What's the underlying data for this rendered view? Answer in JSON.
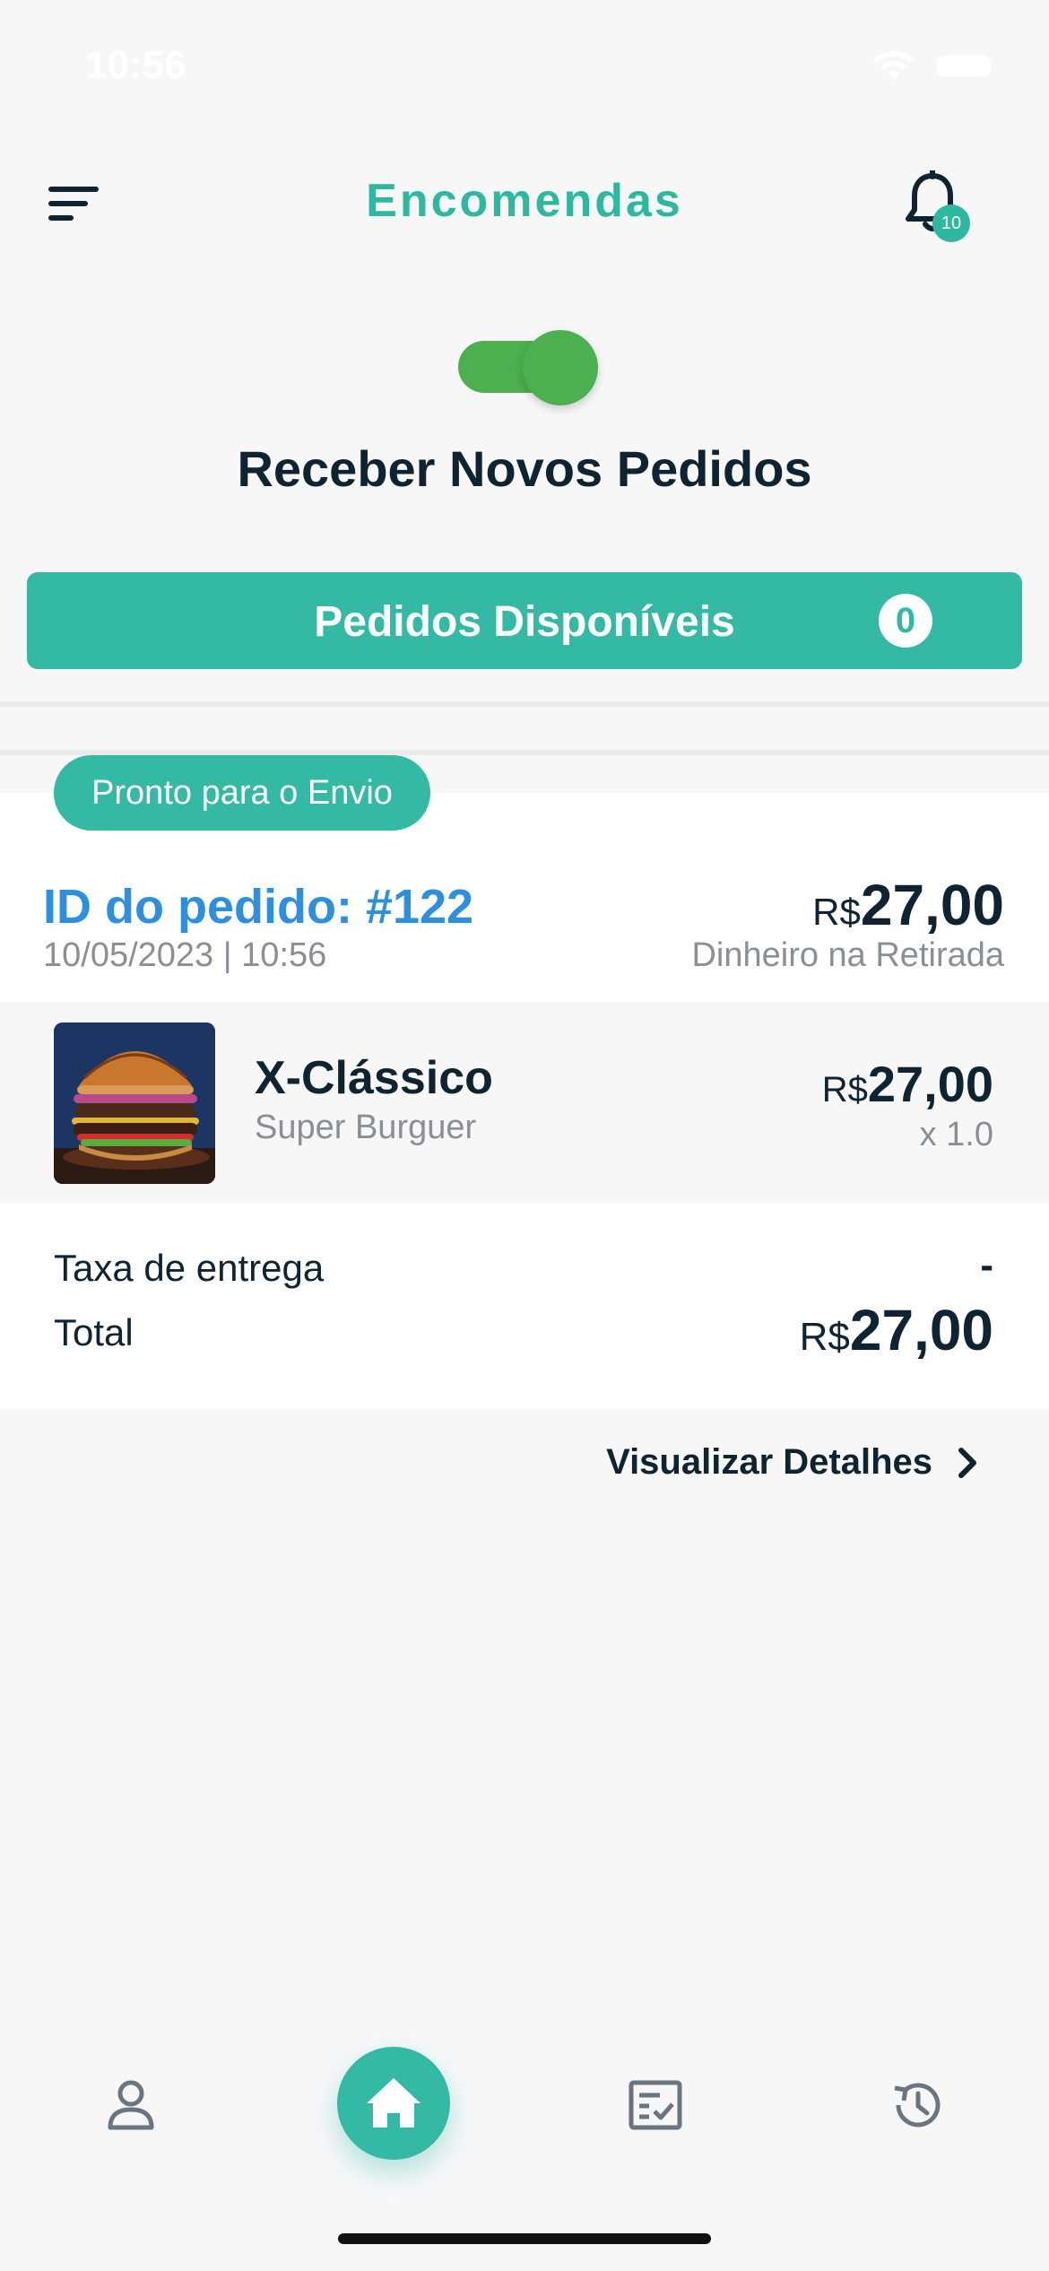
{
  "status_bar": {
    "time": "10:56"
  },
  "header": {
    "title": "Encomendas",
    "notification_count": "10"
  },
  "receive_orders": {
    "label": "Receber Novos Pedidos",
    "enabled": true
  },
  "available_orders": {
    "label": "Pedidos Disponíveis",
    "count": "0"
  },
  "order": {
    "status": "Pronto para o Envio",
    "id_label": "ID do pedido: #122",
    "datetime": "10/05/2023 | 10:56",
    "total_currency": "R$",
    "total_amount": "27,00",
    "payment_method": "Dinheiro na Retirada",
    "items": [
      {
        "name": "X-Clássico",
        "store": "Super Burguer",
        "currency": "R$",
        "price": "27,00",
        "quantity": "x 1.0"
      }
    ],
    "delivery_fee_label": "Taxa de entrega",
    "delivery_fee_value": "-",
    "total_label": "Total",
    "grand_total_currency": "R$",
    "grand_total_amount": "27,00",
    "details_link": "Visualizar Detalhes"
  },
  "tabbar": {
    "tabs": [
      "person-icon",
      "home-icon",
      "checklist-icon",
      "history-icon"
    ],
    "active": "home-icon"
  },
  "colors": {
    "accent": "#34b9a5",
    "toggle_on": "#4caf50",
    "order_id_blue": "#2d8fe0",
    "text_dark": "#0f2430"
  }
}
